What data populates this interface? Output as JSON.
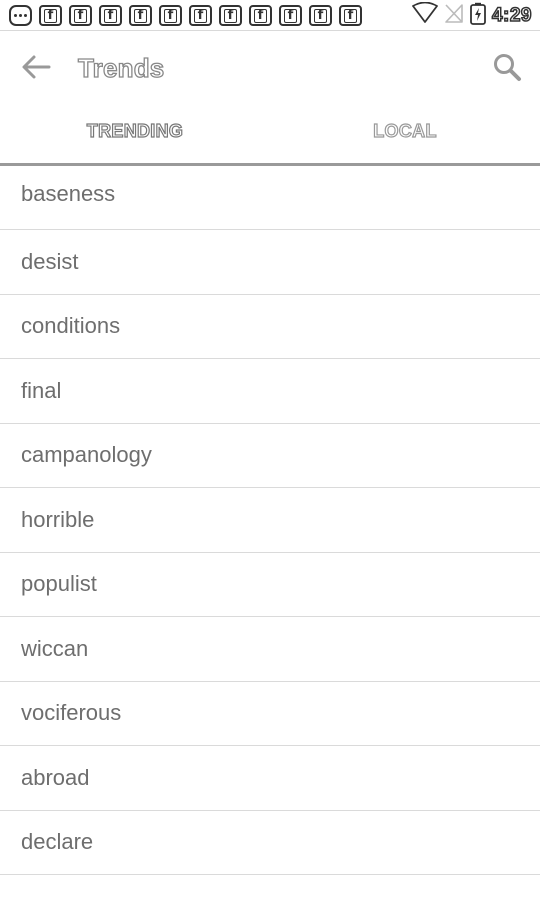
{
  "status_bar": {
    "notification_icons": [
      "chat-icon",
      "facebook-icon",
      "facebook-icon",
      "facebook-icon",
      "facebook-icon",
      "facebook-icon",
      "facebook-icon",
      "facebook-icon",
      "facebook-icon",
      "facebook-icon",
      "facebook-icon",
      "facebook-icon"
    ],
    "time": "4:29"
  },
  "toolbar": {
    "title": "Trends",
    "back_icon": "arrow-left-icon",
    "search_icon": "search-icon"
  },
  "tabs": [
    {
      "label": "TRENDING",
      "active": true
    },
    {
      "label": "LOCAL",
      "active": false
    }
  ],
  "list": {
    "items": [
      "baseness",
      "desist",
      "conditions",
      "final",
      "campanology",
      "horrible",
      "populist",
      "wiccan",
      "vociferous",
      "abroad",
      "declare"
    ]
  },
  "colors": {
    "divider": "#dadada",
    "tab_indicator": "#9a9a9a",
    "text": "#6e6e6e"
  }
}
